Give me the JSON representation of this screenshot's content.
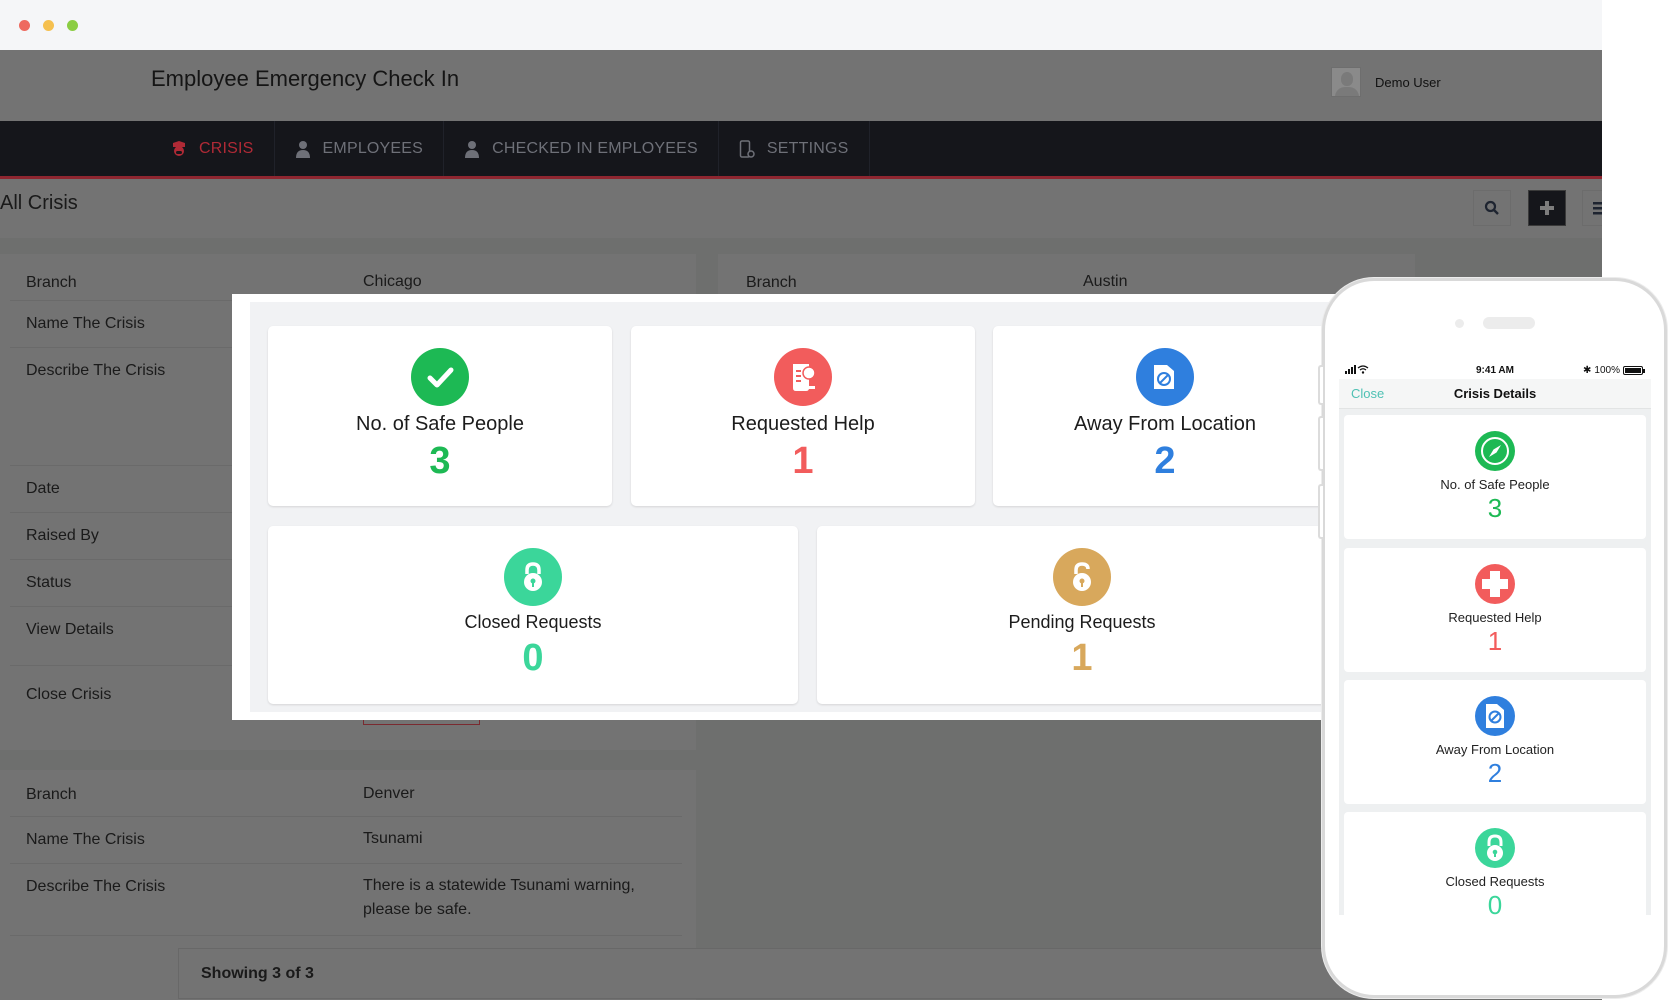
{
  "window": {
    "controls": [
      "close",
      "minimize",
      "maximize"
    ]
  },
  "header": {
    "app_title": "Employee Emergency Check In",
    "user": {
      "name": "Demo User",
      "avatar_icon": "user-silhouette-icon"
    }
  },
  "nav": {
    "items": [
      {
        "label": "CRISIS",
        "icon": "police-officer-icon",
        "active": true
      },
      {
        "label": "EMPLOYEES",
        "icon": "person-icon",
        "active": false
      },
      {
        "label": "CHECKED IN EMPLOYEES",
        "icon": "person-icon",
        "active": false
      },
      {
        "label": "SETTINGS",
        "icon": "device-settings-icon",
        "active": false
      }
    ]
  },
  "page": {
    "title": "All Crisis",
    "toolbar": {
      "search_icon": "search-icon",
      "add_icon": "plus-icon",
      "menu_icon": "menu-icon"
    }
  },
  "crisis_cards": [
    {
      "rows": [
        {
          "key": "Branch",
          "value": "Chicago"
        },
        {
          "key": "Name The Crisis",
          "value": ""
        },
        {
          "key": "Describe The Crisis",
          "value": ""
        },
        {
          "key": "Date",
          "value": ""
        },
        {
          "key": "Raised By",
          "value": ""
        },
        {
          "key": "Status",
          "value": ""
        },
        {
          "key": "View Details",
          "value": ""
        },
        {
          "key": "Close Crisis",
          "value": ""
        }
      ]
    },
    {
      "rows": [
        {
          "key": "Branch",
          "value": "Austin"
        }
      ]
    },
    {
      "rows": [
        {
          "key": "Branch",
          "value": "Denver"
        },
        {
          "key": "Name The Crisis",
          "value": "Tsunami"
        },
        {
          "key": "Describe The Crisis",
          "value": "There is a statewide Tsunami warning, please be safe."
        }
      ]
    }
  ],
  "footer": {
    "showing": "Showing 3 of 3"
  },
  "colors": {
    "safe": "#1db954",
    "help": "#f25c5c",
    "away": "#2f7fde",
    "closed": "#3bd69a",
    "pending": "#d8a85c",
    "nav_active": "#b02a36",
    "phone_close": "#4fc1b4"
  },
  "modal": {
    "stats": [
      {
        "label": "No. of Safe People",
        "value": "3",
        "icon": "checkmark-icon"
      },
      {
        "label": "Requested Help",
        "value": "1",
        "icon": "scroll-certificate-icon"
      },
      {
        "label": "Away From Location",
        "value": "2",
        "icon": "folder-blocked-icon"
      },
      {
        "label": "Closed Requests",
        "value": "0",
        "icon": "padlock-closed-icon"
      },
      {
        "label": "Pending Requests",
        "value": "1",
        "icon": "padlock-open-icon"
      }
    ]
  },
  "phone": {
    "status_bar": {
      "signal": "signal-wifi-icon",
      "time": "9:41 AM",
      "battery_text": "100%"
    },
    "nav": {
      "close_label": "Close",
      "title": "Crisis Details"
    },
    "stats": [
      {
        "label": "No. of Safe People",
        "value": "3",
        "icon": "compass-icon"
      },
      {
        "label": "Requested Help",
        "value": "1",
        "icon": "medical-cross-icon"
      },
      {
        "label": "Away From Location",
        "value": "2",
        "icon": "folder-blocked-icon"
      },
      {
        "label": "Closed Requests",
        "value": "0",
        "icon": "padlock-closed-icon"
      }
    ]
  }
}
